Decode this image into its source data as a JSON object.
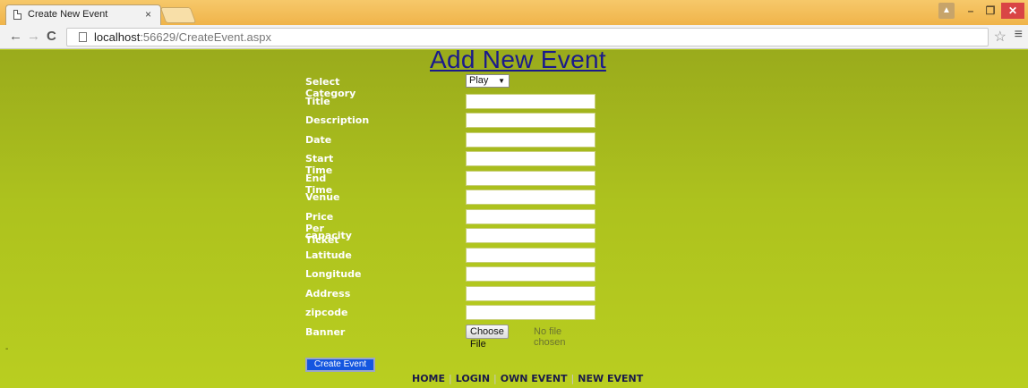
{
  "browser": {
    "tab_title": "Create New Event",
    "tab_close": "×",
    "url_host": "localhost",
    "url_rest": ":56629/CreateEvent.aspx",
    "icons": [
      "page-icon",
      "back-icon",
      "forward-icon",
      "reload-icon",
      "star-icon",
      "menu-icon",
      "user-icon",
      "minimize-icon",
      "maximize-icon",
      "close-icon"
    ]
  },
  "page": {
    "title": "Add New Event",
    "category": {
      "label": "Select Category",
      "value": "Play"
    },
    "fields": [
      {
        "label": "Title",
        "value": ""
      },
      {
        "label": "Description",
        "value": ""
      },
      {
        "label": "Date",
        "value": ""
      },
      {
        "label": "Start Time",
        "value": ""
      },
      {
        "label": "End Time",
        "value": ""
      },
      {
        "label": "Venue",
        "value": ""
      },
      {
        "label": "Price Per Ticket",
        "value": ""
      },
      {
        "label": "capacity",
        "value": ""
      },
      {
        "label": "Latitude",
        "value": ""
      },
      {
        "label": "Longitude",
        "value": ""
      },
      {
        "label": "Address",
        "value": ""
      },
      {
        "label": "zipcode",
        "value": ""
      }
    ],
    "banner": {
      "label": "Banner",
      "button": "Choose File",
      "status": "No file chosen"
    },
    "submit_label": "Create Event",
    "footer": {
      "home": "HOME",
      "login": "LOGIN",
      "own_event": "OWN EVENT",
      "new_event": "NEW EVENT",
      "separator": "|"
    },
    "left_dash": "-"
  },
  "colors": {
    "page_bg_top": "#9aab1c",
    "page_bg_bottom": "#b9ce20",
    "title_link": "#1a1a8c",
    "submit_bg": "#1456e0"
  }
}
